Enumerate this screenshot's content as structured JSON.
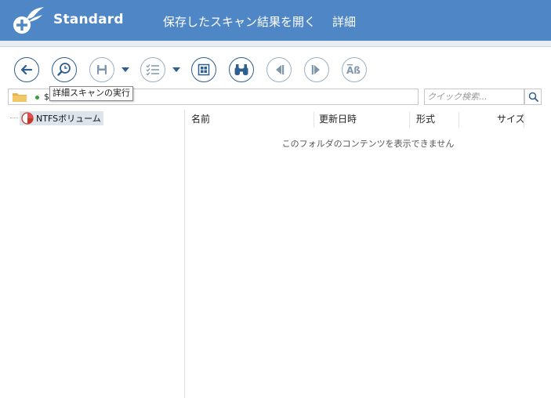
{
  "header": {
    "app_title": "Standard",
    "menu": [
      {
        "label": "保存したスキャン結果を開く"
      },
      {
        "label": "詳細"
      }
    ],
    "colors": {
      "bar": "#4f86c6",
      "accent": "#2f5f8f"
    }
  },
  "toolbar": {
    "buttons": [
      {
        "name": "back-button",
        "icon": "arrow-left-icon",
        "enabled": true
      },
      {
        "name": "deep-scan-button",
        "icon": "magnifier-clock-icon",
        "enabled": true
      },
      {
        "name": "save-button",
        "icon": "floppy-disk-icon",
        "enabled": false
      },
      {
        "name": "checklist-button",
        "icon": "checklist-icon",
        "enabled": false
      },
      {
        "name": "grid-view-button",
        "icon": "grid-icon",
        "enabled": true
      },
      {
        "name": "find-button",
        "icon": "binoculars-icon",
        "enabled": true
      },
      {
        "name": "previous-button",
        "icon": "step-back-icon",
        "enabled": false
      },
      {
        "name": "next-button",
        "icon": "step-forward-icon",
        "enabled": false
      },
      {
        "name": "case-button",
        "icon": "case-ab-icon",
        "enabled": false
      }
    ],
    "tooltip": "詳細スキャンの実行"
  },
  "path_bar": {
    "path_text": "$"
  },
  "search": {
    "placeholder": "クイック検索..."
  },
  "tree": {
    "items": [
      {
        "label": "NTFSボリューム"
      }
    ]
  },
  "file_list": {
    "columns": [
      "名前",
      "更新日時",
      "形式",
      "サイズ"
    ],
    "empty_message": "このフォルダのコンテンツを表示できません"
  }
}
